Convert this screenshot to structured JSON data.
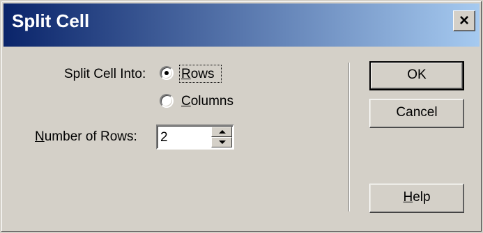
{
  "window": {
    "title": "Split Cell",
    "close_glyph": "✕"
  },
  "form": {
    "split_label": "Split Cell Into:",
    "option_rows": {
      "first": "R",
      "rest": "ows"
    },
    "option_columns": {
      "first": "C",
      "rest": "olumns"
    },
    "number_label": {
      "first": "N",
      "rest": "umber of Rows:"
    },
    "number_value": "2",
    "selected_option": "rows"
  },
  "buttons": {
    "ok": "OK",
    "cancel": "Cancel",
    "help": {
      "first": "H",
      "rest": "elp"
    }
  },
  "colors": {
    "title_gradient_start": "#0a246a",
    "title_gradient_end": "#a6caf0",
    "face": "#d4d0c8"
  }
}
